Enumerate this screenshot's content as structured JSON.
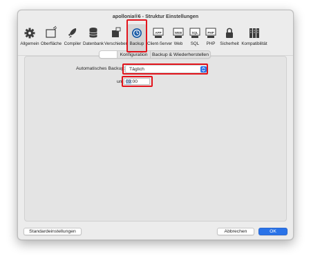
{
  "window": {
    "title": "apollonia®6 - Struktur Einstellungen"
  },
  "toolbar": {
    "items": [
      {
        "label": "Allgemein",
        "icon": "gear-icon"
      },
      {
        "label": "Oberfläche",
        "icon": "window-icon"
      },
      {
        "label": "Compiler",
        "icon": "rocket-icon"
      },
      {
        "label": "Datenbank",
        "icon": "database-icon"
      },
      {
        "label": "Verschieben",
        "icon": "move-icon"
      },
      {
        "label": "Backup",
        "icon": "backup-icon",
        "selected": true
      },
      {
        "label": "Client-Server",
        "icon": "client-server-icon",
        "badge": "APP"
      },
      {
        "label": "Web",
        "icon": "web-icon",
        "badge": "WEB"
      },
      {
        "label": "SQL",
        "icon": "sql-icon",
        "badge": "SQL"
      },
      {
        "label": "PHP",
        "icon": "php-icon",
        "badge": "PHP"
      },
      {
        "label": "Sicherheit",
        "icon": "lock-icon"
      },
      {
        "label": "Kompatibilität",
        "icon": "server-rack-icon"
      }
    ]
  },
  "tabs": [
    {
      "label": "",
      "active": true
    },
    {
      "label": "Konfiguration",
      "active": false
    },
    {
      "label": "Backup & Wiederherstellen",
      "active": false
    }
  ],
  "form": {
    "auto_backup_label": "Automatisches Backup:",
    "auto_backup_value": "Täglich",
    "time_label": "um",
    "time_hours": "03",
    "time_sep_minutes": ":00"
  },
  "buttons": {
    "defaults": "Standardeinstellungen",
    "cancel": "Abbrechen",
    "ok": "OK"
  },
  "colors": {
    "accent": "#2a73e8",
    "highlight": "#e3131b",
    "window_bg": "#ececec"
  }
}
